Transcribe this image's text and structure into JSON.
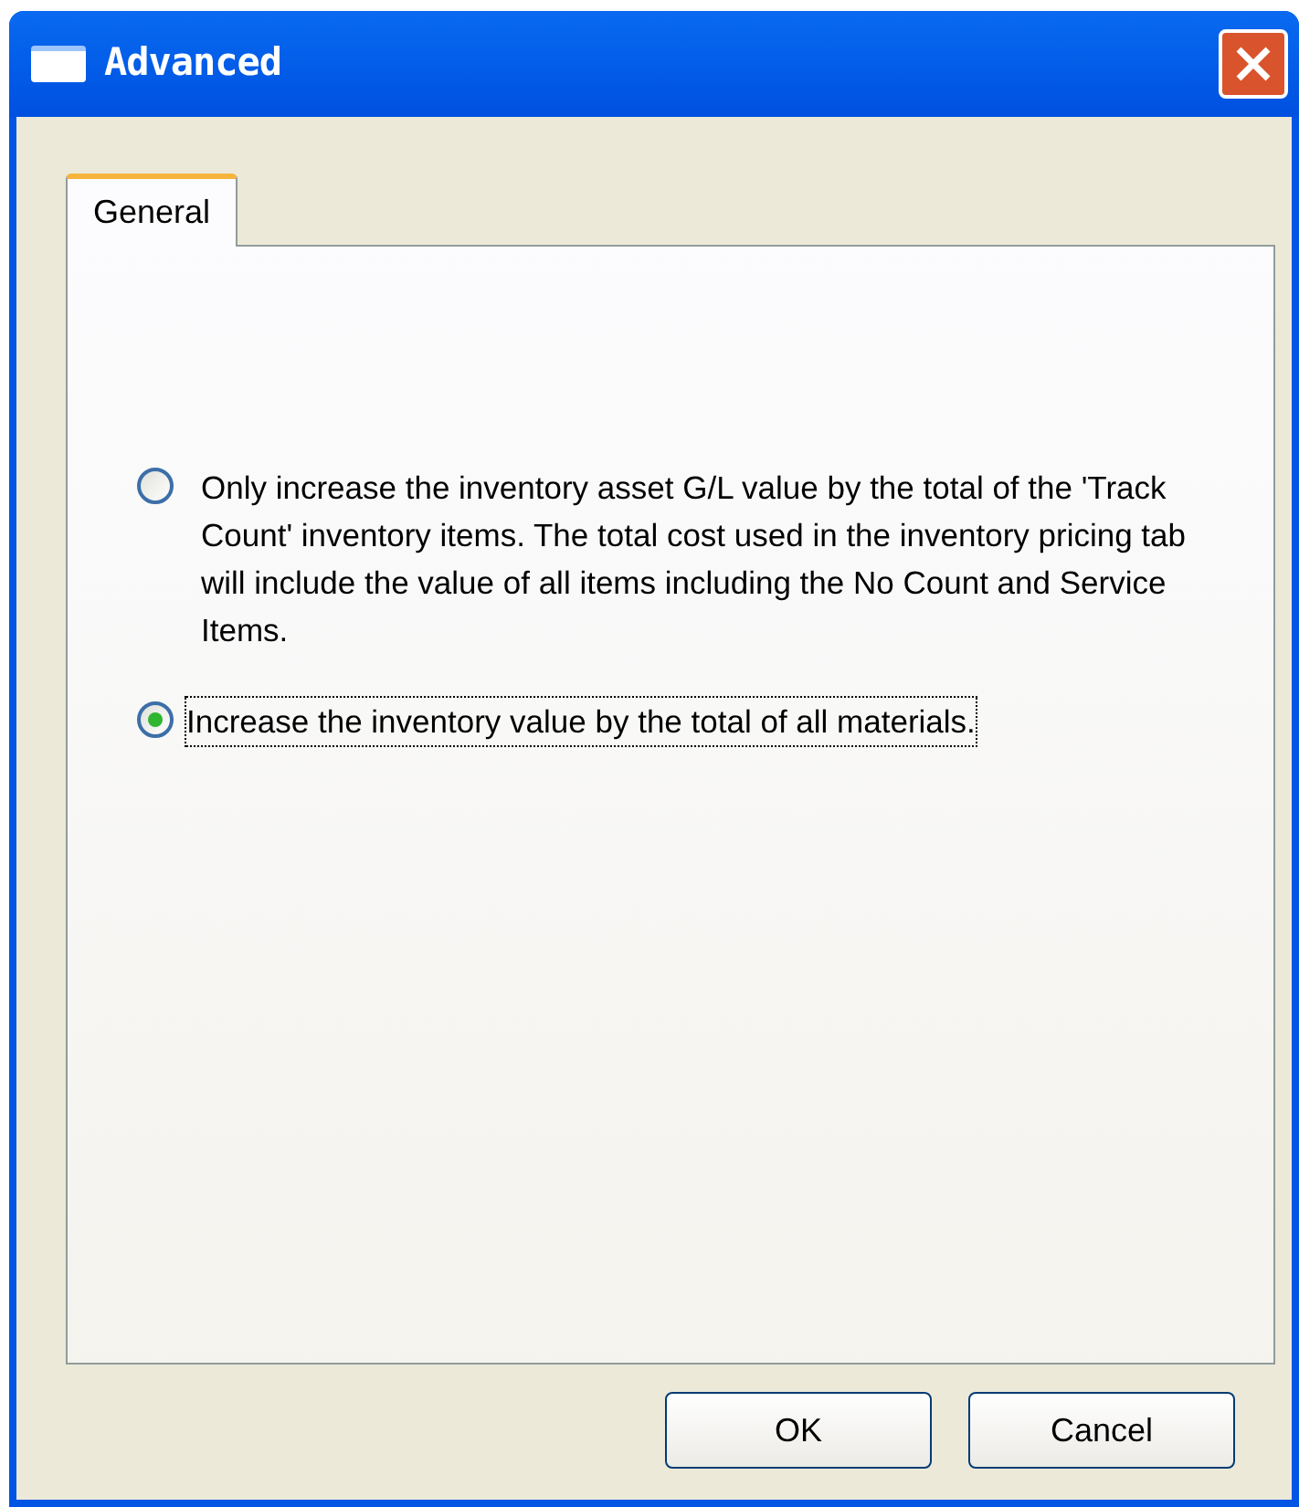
{
  "window": {
    "title": "Advanced"
  },
  "tabs": [
    {
      "label": "General",
      "selected": true
    }
  ],
  "options": [
    {
      "label": "Only increase the inventory asset G/L value by the total of the 'Track Count' inventory items. The total cost used in the inventory pricing tab will include the value of all items including the No Count and Service Items.",
      "selected": false,
      "focused": false
    },
    {
      "label": "Increase the inventory value by the total of all materials.",
      "selected": true,
      "focused": true
    }
  ],
  "buttons": [
    "OK",
    "Cancel"
  ]
}
